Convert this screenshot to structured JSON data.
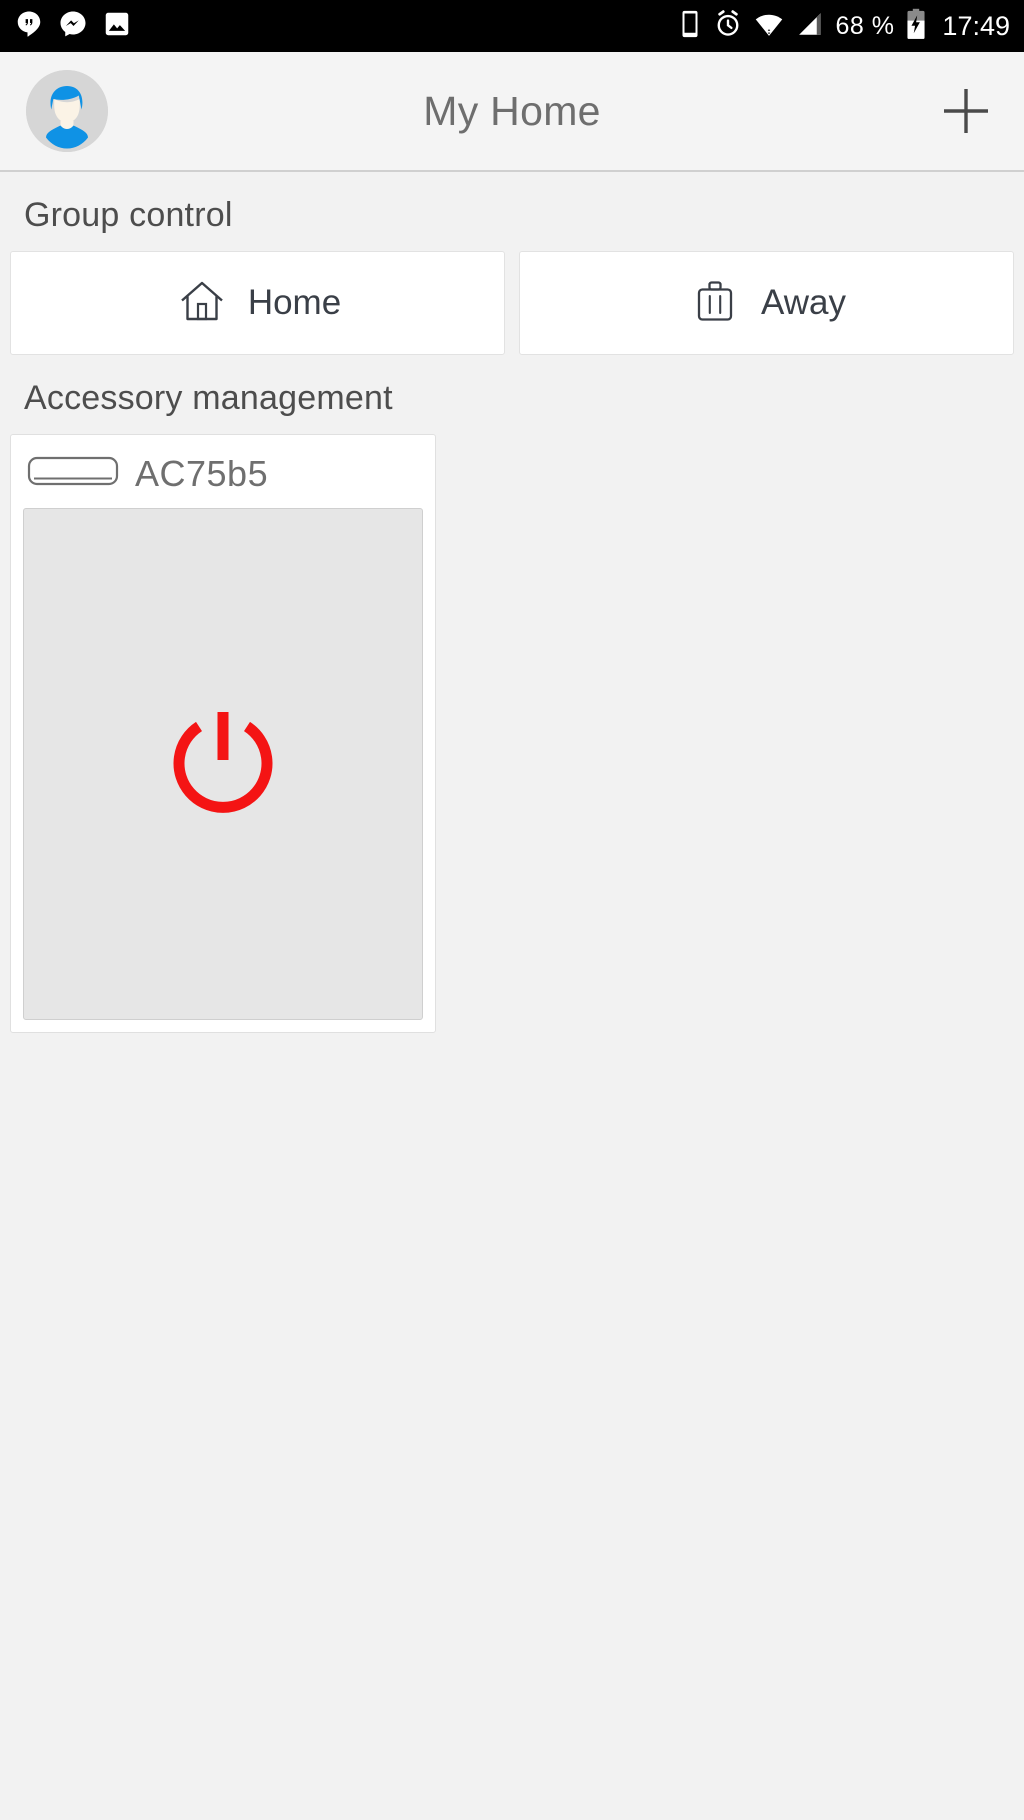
{
  "status_bar": {
    "left_icons": [
      {
        "name": "hangouts-icon",
        "label": "Hangouts"
      },
      {
        "name": "messenger-icon",
        "label": "Messenger"
      },
      {
        "name": "photo-icon",
        "label": "Photo"
      }
    ],
    "right_icons": [
      {
        "name": "vibrate-phone-icon",
        "label": "Vibrate"
      },
      {
        "name": "alarm-clock-icon",
        "label": "Alarm set"
      },
      {
        "name": "wifi-icon",
        "label": "Wi-Fi"
      },
      {
        "name": "cellular-signal-icon",
        "label": "Cellular signal"
      }
    ],
    "battery_percent": "68 %",
    "battery_icon": "battery-charging-icon",
    "clock": "17:49",
    "background_color": "#000000",
    "foreground_color": "#ffffff"
  },
  "app_bar": {
    "avatar_name": "avatar",
    "title": "My Home",
    "add_label": "+",
    "background_color": "#f4f4f4",
    "title_color": "#6e6e6e"
  },
  "group_control": {
    "section_title": "Group control",
    "buttons": [
      {
        "label": "Home",
        "icon": "house-icon"
      },
      {
        "label": "Away",
        "icon": "suitcase-icon"
      }
    ]
  },
  "accessory_management": {
    "section_title": "Accessory management",
    "devices": [
      {
        "name": "AC75b5",
        "icon": "air-conditioner-icon",
        "power_state": "off",
        "power_icon": "power-icon",
        "power_color": "#f41414",
        "panel_color": "#e6e6e6"
      }
    ]
  }
}
